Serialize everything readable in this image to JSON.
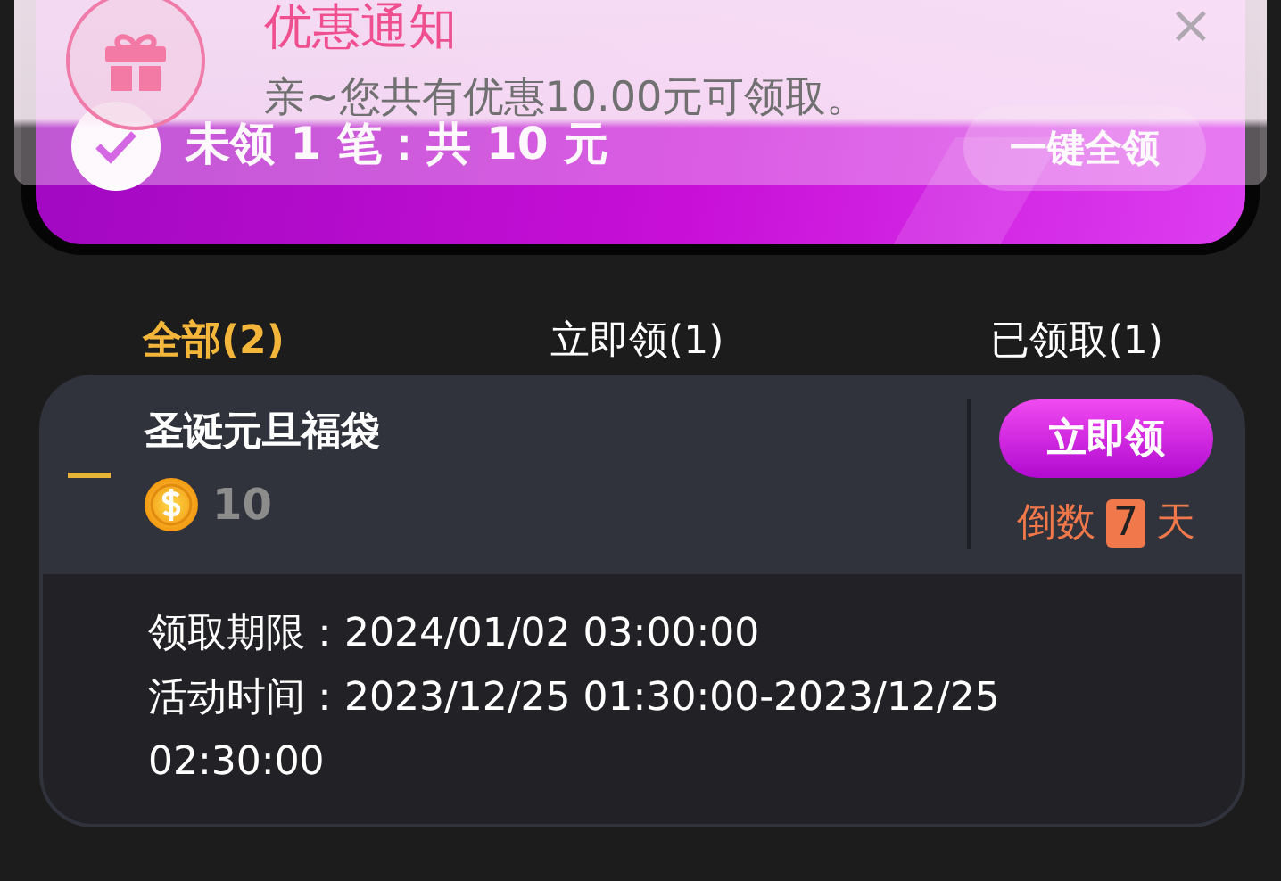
{
  "notification": {
    "title": "优惠通知",
    "message": "亲~您共有优惠10.00元可领取。",
    "close": "×"
  },
  "summary": {
    "checked": true,
    "text": "未领 1 笔：共 10 元",
    "button": "一键全领"
  },
  "tabs": [
    {
      "label": "全部(2)",
      "selected": true
    },
    {
      "label": "立即领(1)",
      "selected": false
    },
    {
      "label": "已领取(1)",
      "selected": false
    }
  ],
  "coupons": [
    {
      "title": "圣诞元旦福袋",
      "amount": "10",
      "button": "立即领",
      "countdown_prefix": "倒数",
      "countdown_days": "7",
      "countdown_suffix": "天",
      "expanded": true,
      "details": [
        "领取期限：2024/01/02 03:00:00",
        "活动时间：2023/12/25 01:30:00-2023/12/25 02:30:00"
      ]
    }
  ]
}
